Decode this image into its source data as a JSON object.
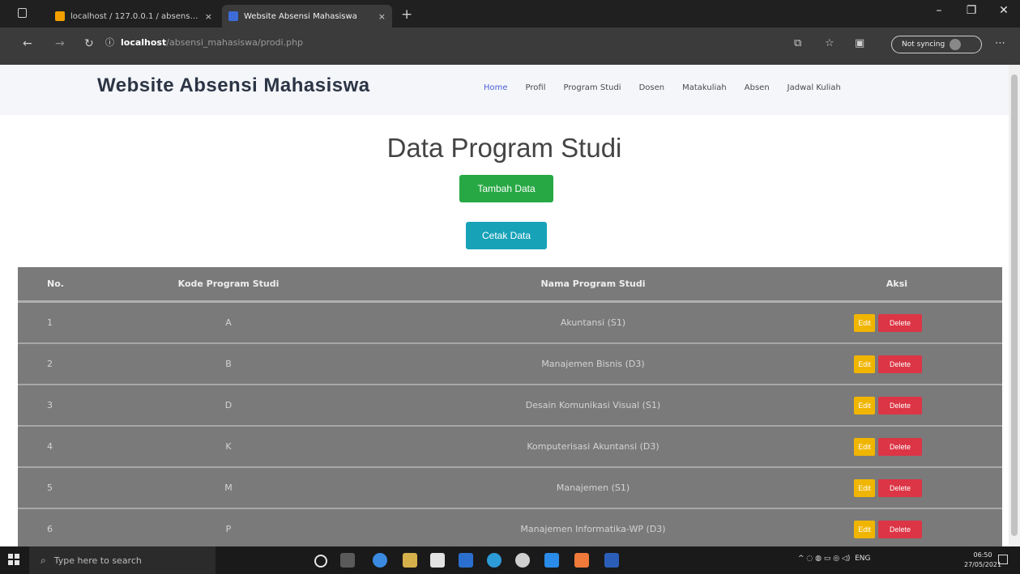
{
  "browser": {
    "tabs": [
      {
        "title": "localhost / 127.0.0.1 / absensi_m",
        "close": "×"
      },
      {
        "title": "Website Absensi Mahasiswa",
        "close": "×"
      }
    ],
    "new_tab": "+",
    "address": {
      "host": "localhost",
      "path": "/absensi_mahasiswa/prodi.php"
    },
    "sync_label": "Not syncing",
    "window_controls": [
      "–",
      "❐",
      "✕"
    ]
  },
  "site": {
    "brand": "Website Absensi Mahasiswa",
    "nav": [
      "Home",
      "Profil",
      "Program Studi",
      "Dosen",
      "Matakuliah",
      "Absen",
      "Jadwal Kuliah"
    ],
    "page_title": "Data Program Studi",
    "buttons": {
      "add": "Tambah Data",
      "print": "Cetak Data"
    },
    "table": {
      "headers": [
        "No.",
        "Kode Program Studi",
        "Nama Program Studi",
        "Aksi"
      ],
      "edit_label": "Edit",
      "delete_label": "Delete",
      "rows": [
        {
          "no": "1",
          "kode": "A",
          "nama": "Akuntansi (S1)"
        },
        {
          "no": "2",
          "kode": "B",
          "nama": "Manajemen Bisnis (D3)"
        },
        {
          "no": "3",
          "kode": "D",
          "nama": "Desain Komunikasi Visual (S1)"
        },
        {
          "no": "4",
          "kode": "K",
          "nama": "Komputerisasi Akuntansi (D3)"
        },
        {
          "no": "5",
          "kode": "M",
          "nama": "Manajemen (S1)"
        },
        {
          "no": "6",
          "kode": "P",
          "nama": "Manajemen Informatika-WP (D3)"
        }
      ]
    }
  },
  "taskbar": {
    "search_placeholder": "Type here to search",
    "tray_text": "ENG",
    "time": "06:50",
    "date": "27/05/2021"
  },
  "colors": {
    "add_button": "#27a844",
    "print_button": "#17a2b8",
    "edit_button": "#f0b500",
    "delete_button": "#dc3545",
    "table_bg": "#7a7a7a"
  }
}
